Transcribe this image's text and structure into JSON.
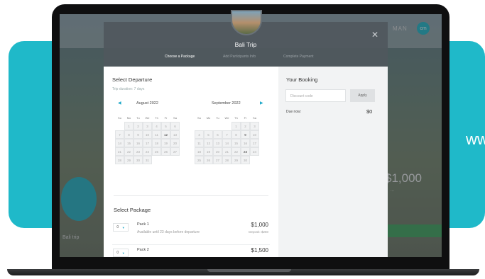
{
  "background": {
    "url_fragment": "ww",
    "accent_color": "#1fb9c9"
  },
  "site": {
    "logo_text": "MAN",
    "logo_badge": "cm",
    "price": "$1,000",
    "price_sub": "...",
    "trip_label": "Bali trip"
  },
  "modal": {
    "title": "Bali Trip",
    "close_icon": "close-icon",
    "steps": [
      "Choose a Package",
      "Add Participants Info",
      "Complete Payment"
    ],
    "select_departure": {
      "heading": "Select Departure",
      "duration": "Trip duration: 7 days",
      "weekdays": [
        "Su",
        "Mo",
        "Tu",
        "We",
        "Th",
        "Fr",
        "Sa"
      ],
      "calendars": [
        {
          "month": "August 2022",
          "nav_icon": "chevron-left-icon",
          "days": [
            "",
            "1",
            "2",
            "3",
            "4",
            "5",
            "6",
            "7",
            "8",
            "9",
            "10",
            "11",
            "12",
            "13",
            "14",
            "15",
            "16",
            "17",
            "18",
            "19",
            "20",
            "21",
            "22",
            "23",
            "24",
            "25",
            "26",
            "27",
            "28",
            "29",
            "30",
            "31",
            "",
            "",
            ""
          ],
          "available": [
            "12"
          ]
        },
        {
          "month": "September 2022",
          "nav_icon": "chevron-right-icon",
          "days": [
            "",
            "",
            "",
            "",
            "1",
            "2",
            "3",
            "4",
            "5",
            "6",
            "7",
            "8",
            "9",
            "10",
            "11",
            "12",
            "13",
            "14",
            "15",
            "16",
            "17",
            "18",
            "19",
            "20",
            "21",
            "22",
            "23",
            "24",
            "25",
            "26",
            "27",
            "28",
            "29",
            "30",
            ""
          ],
          "available": [
            "9",
            "23"
          ]
        }
      ]
    },
    "select_package": {
      "heading": "Select Package",
      "packages": [
        {
          "qty": "0",
          "name": "Pack 1",
          "availability": "Available until 23 days before departure",
          "price": "$1,000",
          "deposit": "Deposit: $250"
        },
        {
          "qty": "0",
          "name": "Pack 2",
          "availability": "",
          "price": "$1,500",
          "deposit": ""
        }
      ]
    },
    "booking": {
      "heading": "Your Booking",
      "discount_placeholder": "Discount code",
      "apply_label": "Apply",
      "due_label": "Due now:",
      "due_value": "$0"
    }
  }
}
